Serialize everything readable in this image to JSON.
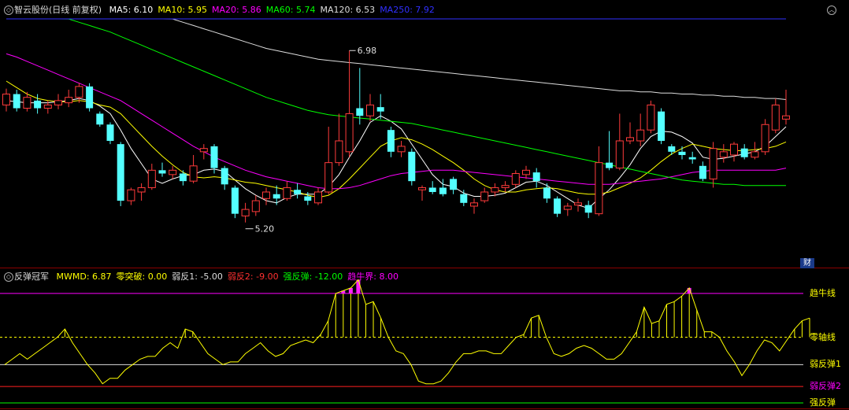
{
  "main_header": {
    "stock": "智云股份",
    "mode": "(日线 前复权)",
    "ma": [
      {
        "label": "MA5: 6.10",
        "color": "#ffffff"
      },
      {
        "label": "MA10: 5.95",
        "color": "#ffff00"
      },
      {
        "label": "MA20: 5.86",
        "color": "#ff00ff"
      },
      {
        "label": "MA60: 5.74",
        "color": "#00ff00"
      },
      {
        "label": "MA120: 6.53",
        "color": "#dddddd"
      },
      {
        "label": "MA250: 7.92",
        "color": "#3030ff"
      }
    ]
  },
  "indicator_header": {
    "name": "反弹冠军",
    "items": [
      {
        "label": "MWMD: 6.87",
        "color": "#ffff00"
      },
      {
        "label": "零突破: 0.00",
        "color": "#ffff00"
      },
      {
        "label": "弱反1: -5.00",
        "color": "#dddddd"
      },
      {
        "label": "弱反2: -9.00",
        "color": "#ff3030"
      },
      {
        "label": "强反弹: -12.00",
        "color": "#00ff00"
      },
      {
        "label": "趋牛界: 8.00",
        "color": "#ff00ff"
      }
    ]
  },
  "price_annotations": {
    "high": "6.98",
    "low": "5.20"
  },
  "fin_badge": "财",
  "right_labels": {
    "bull_line": "趋牛线",
    "zero_line": "零轴线",
    "weak1": "弱反弹1",
    "weak2": "弱反弹2",
    "strong": "强反弹"
  },
  "chart_data": [
    {
      "type": "candlestick",
      "price_range": [
        5.0,
        7.3
      ],
      "candles": [
        [
          6.48,
          6.58,
          6.63,
          6.42
        ],
        [
          6.58,
          6.45,
          6.62,
          6.42
        ],
        [
          6.45,
          6.55,
          6.6,
          6.42
        ],
        [
          6.52,
          6.45,
          6.58,
          6.4
        ],
        [
          6.45,
          6.48,
          6.52,
          6.4
        ],
        [
          6.48,
          6.52,
          6.58,
          6.44
        ],
        [
          6.5,
          6.55,
          6.62,
          6.46
        ],
        [
          6.55,
          6.65,
          6.68,
          6.5
        ],
        [
          6.65,
          6.45,
          6.68,
          6.42
        ],
        [
          6.4,
          6.3,
          6.42,
          6.28
        ],
        [
          6.3,
          6.15,
          6.32,
          6.12
        ],
        [
          6.12,
          5.6,
          6.14,
          5.55
        ],
        [
          5.6,
          5.7,
          5.72,
          5.56
        ],
        [
          5.68,
          5.72,
          5.76,
          5.6
        ],
        [
          5.72,
          5.88,
          5.94,
          5.7
        ],
        [
          5.88,
          5.85,
          5.95,
          5.82
        ],
        [
          5.84,
          5.88,
          5.92,
          5.8
        ],
        [
          5.85,
          5.78,
          5.88,
          5.74
        ],
        [
          5.78,
          5.92,
          6.02,
          5.76
        ],
        [
          6.05,
          6.08,
          6.12,
          5.98
        ],
        [
          6.1,
          5.9,
          6.12,
          5.85
        ],
        [
          5.9,
          5.75,
          5.92,
          5.7
        ],
        [
          5.72,
          5.48,
          5.74,
          5.44
        ],
        [
          5.46,
          5.52,
          5.58,
          5.4
        ],
        [
          5.5,
          5.6,
          5.65,
          5.46
        ],
        [
          5.62,
          5.68,
          5.72,
          5.56
        ],
        [
          5.66,
          5.62,
          5.74,
          5.56
        ],
        [
          5.62,
          5.72,
          5.78,
          5.6
        ],
        [
          5.7,
          5.66,
          5.76,
          5.62
        ],
        [
          5.64,
          5.6,
          5.68,
          5.56
        ],
        [
          5.58,
          5.68,
          5.72,
          5.56
        ],
        [
          5.68,
          5.95,
          6.28,
          5.66
        ],
        [
          5.95,
          6.15,
          6.4,
          5.92
        ],
        [
          6.05,
          6.4,
          6.98,
          6.0
        ],
        [
          6.45,
          6.38,
          6.82,
          6.3
        ],
        [
          6.38,
          6.48,
          6.58,
          6.33
        ],
        [
          6.46,
          6.42,
          6.58,
          6.35
        ],
        [
          6.25,
          6.05,
          6.28,
          6.0
        ],
        [
          6.05,
          6.1,
          6.15,
          6.0
        ],
        [
          6.05,
          5.78,
          6.08,
          5.74
        ],
        [
          5.7,
          5.72,
          5.74,
          5.6
        ],
        [
          5.72,
          5.68,
          5.78,
          5.66
        ],
        [
          5.72,
          5.66,
          5.8,
          5.64
        ],
        [
          5.8,
          5.7,
          5.82,
          5.66
        ],
        [
          5.66,
          5.58,
          5.7,
          5.55
        ],
        [
          5.55,
          5.58,
          5.62,
          5.48
        ],
        [
          5.6,
          5.68,
          5.72,
          5.58
        ],
        [
          5.68,
          5.72,
          5.76,
          5.64
        ],
        [
          5.72,
          5.74,
          5.78,
          5.68
        ],
        [
          5.75,
          5.85,
          5.88,
          5.72
        ],
        [
          5.84,
          5.88,
          5.92,
          5.8
        ],
        [
          5.86,
          5.78,
          5.9,
          5.72
        ],
        [
          5.72,
          5.62,
          5.76,
          5.58
        ],
        [
          5.62,
          5.48,
          5.64,
          5.45
        ],
        [
          5.52,
          5.55,
          5.58,
          5.46
        ],
        [
          5.56,
          5.58,
          5.62,
          5.5
        ],
        [
          5.56,
          5.49,
          5.6,
          5.44
        ],
        [
          5.48,
          5.95,
          6.1,
          5.46
        ],
        [
          5.95,
          5.9,
          6.24,
          5.88
        ],
        [
          5.9,
          6.15,
          6.4,
          5.88
        ],
        [
          6.15,
          6.18,
          6.32,
          6.12
        ],
        [
          6.15,
          6.25,
          6.4,
          6.1
        ],
        [
          6.25,
          6.48,
          6.52,
          6.22
        ],
        [
          6.42,
          6.15,
          6.45,
          6.12
        ],
        [
          6.1,
          6.05,
          6.12,
          6.02
        ],
        [
          6.05,
          6.02,
          6.1,
          5.98
        ],
        [
          6.0,
          5.98,
          6.05,
          5.94
        ],
        [
          5.92,
          5.8,
          5.96,
          5.78
        ],
        [
          5.8,
          6.08,
          6.14,
          5.72
        ],
        [
          6.0,
          6.05,
          6.12,
          5.95
        ],
        [
          6.02,
          6.12,
          6.14,
          5.96
        ],
        [
          6.08,
          6.0,
          6.12,
          5.98
        ],
        [
          6.0,
          6.05,
          6.14,
          5.98
        ],
        [
          6.05,
          6.3,
          6.35,
          6.02
        ],
        [
          6.25,
          6.48,
          6.54,
          6.22
        ],
        [
          6.35,
          6.38,
          6.62,
          6.3
        ]
      ],
      "series": [
        {
          "name": "MA5",
          "color": "#ffffff",
          "values": [
            6.52,
            6.51,
            6.5,
            6.5,
            6.5,
            6.51,
            6.52,
            6.54,
            6.52,
            6.47,
            6.4,
            6.25,
            6.08,
            5.94,
            5.8,
            5.76,
            5.8,
            5.83,
            5.84,
            5.88,
            5.89,
            5.87,
            5.79,
            5.71,
            5.65,
            5.6,
            5.58,
            5.63,
            5.66,
            5.66,
            5.66,
            5.73,
            5.84,
            6.0,
            6.15,
            6.32,
            6.38,
            6.33,
            6.26,
            6.12,
            5.98,
            5.84,
            5.75,
            5.73,
            5.67,
            5.64,
            5.64,
            5.65,
            5.67,
            5.72,
            5.77,
            5.78,
            5.74,
            5.68,
            5.62,
            5.56,
            5.53,
            5.62,
            5.7,
            5.81,
            5.93,
            6.08,
            6.19,
            6.24,
            6.23,
            6.19,
            6.13,
            6.0,
            5.98,
            5.99,
            6.01,
            6.03,
            6.05,
            6.1,
            6.19,
            6.28
          ]
        },
        {
          "name": "MA10",
          "color": "#ffff00",
          "values": [
            6.7,
            6.64,
            6.58,
            6.54,
            6.52,
            6.51,
            6.51,
            6.52,
            6.51,
            6.48,
            6.46,
            6.4,
            6.3,
            6.2,
            6.1,
            6.01,
            5.93,
            5.86,
            5.82,
            5.81,
            5.82,
            5.81,
            5.79,
            5.77,
            5.76,
            5.74,
            5.72,
            5.7,
            5.68,
            5.65,
            5.63,
            5.65,
            5.71,
            5.8,
            5.9,
            6.0,
            6.1,
            6.15,
            6.18,
            6.16,
            6.12,
            6.07,
            6.01,
            5.95,
            5.88,
            5.8,
            5.74,
            5.7,
            5.68,
            5.68,
            5.7,
            5.71,
            5.72,
            5.71,
            5.69,
            5.67,
            5.66,
            5.66,
            5.68,
            5.72,
            5.76,
            5.81,
            5.88,
            5.96,
            6.03,
            6.08,
            6.12,
            6.1,
            6.08,
            6.07,
            6.06,
            6.06,
            6.07,
            6.08,
            6.1,
            6.14
          ]
        },
        {
          "name": "MA20",
          "color": "#ff00ff",
          "values": [
            6.95,
            6.92,
            6.88,
            6.84,
            6.8,
            6.76,
            6.72,
            6.68,
            6.64,
            6.6,
            6.56,
            6.52,
            6.46,
            6.4,
            6.34,
            6.28,
            6.22,
            6.16,
            6.1,
            6.05,
            6.0,
            5.96,
            5.92,
            5.88,
            5.85,
            5.82,
            5.8,
            5.78,
            5.76,
            5.74,
            5.72,
            5.71,
            5.71,
            5.72,
            5.74,
            5.77,
            5.8,
            5.83,
            5.85,
            5.86,
            5.87,
            5.88,
            5.88,
            5.88,
            5.87,
            5.86,
            5.85,
            5.84,
            5.83,
            5.82,
            5.81,
            5.8,
            5.79,
            5.78,
            5.77,
            5.76,
            5.75,
            5.75,
            5.75,
            5.76,
            5.77,
            5.78,
            5.79,
            5.8,
            5.82,
            5.84,
            5.86,
            5.87,
            5.88,
            5.88,
            5.88,
            5.88,
            5.88,
            5.88,
            5.88,
            5.9
          ]
        },
        {
          "name": "MA60",
          "color": "#00ff00",
          "values": [
            7.45,
            7.42,
            7.39,
            7.36,
            7.33,
            7.3,
            7.27,
            7.24,
            7.21,
            7.18,
            7.15,
            7.11,
            7.07,
            7.03,
            6.99,
            6.95,
            6.91,
            6.87,
            6.83,
            6.79,
            6.75,
            6.71,
            6.67,
            6.63,
            6.59,
            6.55,
            6.52,
            6.49,
            6.46,
            6.43,
            6.41,
            6.39,
            6.38,
            6.37,
            6.36,
            6.35,
            6.34,
            6.33,
            6.32,
            6.31,
            6.29,
            6.27,
            6.25,
            6.23,
            6.21,
            6.19,
            6.17,
            6.15,
            6.13,
            6.11,
            6.09,
            6.07,
            6.05,
            6.03,
            6.01,
            5.99,
            5.97,
            5.95,
            5.93,
            5.91,
            5.89,
            5.87,
            5.85,
            5.83,
            5.81,
            5.79,
            5.78,
            5.77,
            5.76,
            5.75,
            5.75,
            5.74,
            5.74,
            5.74,
            5.74,
            5.74
          ]
        },
        {
          "name": "MA120",
          "color": "#dddddd",
          "values": [
            7.75,
            7.72,
            7.69,
            7.66,
            7.63,
            7.6,
            7.57,
            7.54,
            7.51,
            7.48,
            7.45,
            7.42,
            7.39,
            7.36,
            7.33,
            7.3,
            7.27,
            7.24,
            7.21,
            7.18,
            7.15,
            7.12,
            7.09,
            7.06,
            7.03,
            7.0,
            6.98,
            6.96,
            6.94,
            6.92,
            6.9,
            6.89,
            6.88,
            6.87,
            6.86,
            6.85,
            6.84,
            6.83,
            6.82,
            6.81,
            6.8,
            6.79,
            6.78,
            6.77,
            6.76,
            6.75,
            6.74,
            6.73,
            6.72,
            6.71,
            6.7,
            6.69,
            6.68,
            6.67,
            6.66,
            6.65,
            6.64,
            6.63,
            6.62,
            6.61,
            6.61,
            6.6,
            6.6,
            6.59,
            6.59,
            6.58,
            6.58,
            6.57,
            6.57,
            6.56,
            6.56,
            6.55,
            6.55,
            6.54,
            6.54,
            6.53
          ]
        },
        {
          "name": "MA250",
          "color": "#3030ff",
          "values": [
            8.45,
            8.44,
            8.43,
            8.42,
            8.41,
            8.4,
            8.39,
            8.38,
            8.37,
            8.36,
            8.35,
            8.34,
            8.33,
            8.32,
            8.31,
            8.3,
            8.29,
            8.28,
            8.27,
            8.26,
            8.25,
            8.24,
            8.23,
            8.22,
            8.21,
            8.2,
            8.19,
            8.18,
            8.17,
            8.16,
            8.15,
            8.14,
            8.13,
            8.12,
            8.11,
            8.1,
            8.09,
            8.08,
            8.07,
            8.06,
            8.05,
            8.04,
            8.03,
            8.02,
            8.01,
            8.0,
            7.99,
            7.98,
            7.98,
            7.97,
            7.97,
            7.96,
            7.96,
            7.95,
            7.95,
            7.95,
            7.94,
            7.94,
            7.94,
            7.93,
            7.93,
            7.93,
            7.93,
            7.93,
            7.92,
            7.92,
            7.92,
            7.92,
            7.92,
            7.92,
            7.92,
            7.92,
            7.92,
            7.92,
            7.92,
            7.92
          ]
        }
      ]
    },
    {
      "type": "line",
      "title": "反弹冠军",
      "ylim": [
        -13,
        11
      ],
      "levels": {
        "bull": 8.0,
        "zero": 0.0,
        "weak1": -5.0,
        "weak2": -9.0,
        "strong": -12.0
      },
      "series": [
        {
          "name": "MWMD",
          "color": "#ffff00",
          "values": [
            -5.0,
            -4.0,
            -3.0,
            -4.0,
            -3.0,
            -2.0,
            -1.0,
            0.0,
            1.5,
            -1.0,
            -3.0,
            -5.0,
            -6.5,
            -8.5,
            -7.5,
            -7.5,
            -6.0,
            -5.0,
            -4.0,
            -3.5,
            -3.5,
            -2.0,
            -1.0,
            -2.0,
            1.5,
            1.0,
            -1.0,
            -3.0,
            -4.0,
            -5.0,
            -4.5,
            -4.5,
            -3.0,
            -2.0,
            -1.0,
            -2.5,
            -3.5,
            -3.0,
            -1.5,
            -1.0,
            -0.5,
            -1.0,
            0.5,
            3.0,
            8.0,
            8.5,
            9.0,
            10.5,
            6.0,
            6.5,
            3.5,
            0.0,
            -2.5,
            -3.0,
            -5.0,
            -8.0,
            -8.5,
            -8.5,
            -8.0,
            -6.5,
            -4.5,
            -3.0,
            -3.0,
            -2.5,
            -2.5,
            -3.0,
            -3.0,
            -1.5,
            0.0,
            0.5,
            3.5,
            4.0,
            0.0,
            -3.0,
            -3.5,
            -3.0,
            -2.0,
            -1.5,
            -2.0,
            -3.0,
            -4.0,
            -4.0,
            -3.0,
            -1.0,
            1.0,
            5.5,
            2.5,
            3.0,
            6.0,
            6.5,
            7.5,
            9.0,
            5.0,
            1.0,
            1.0,
            0.0,
            -2.5,
            -4.5,
            -7.0,
            -5.0,
            -2.5,
            -0.5,
            -1.0,
            -2.5,
            -0.5,
            1.5,
            3.0,
            3.5
          ]
        }
      ]
    }
  ]
}
